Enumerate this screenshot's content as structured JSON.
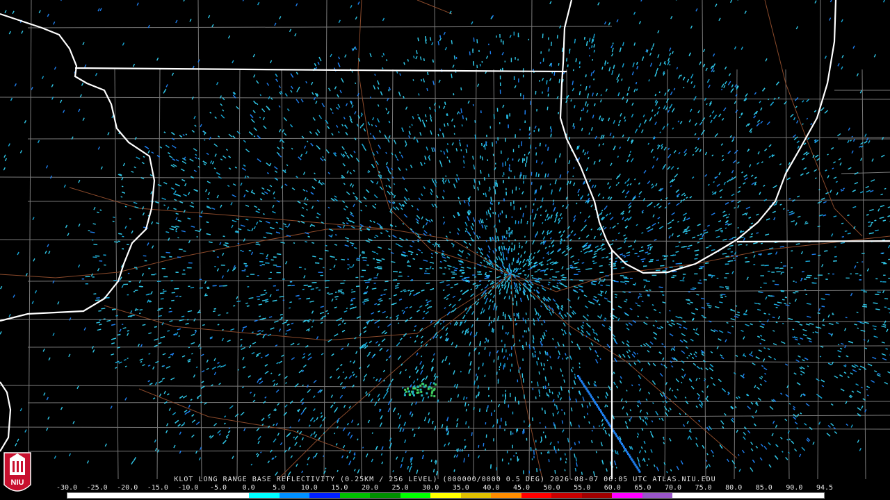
{
  "caption": {
    "site": "KLOT",
    "text": "KLOT LONG RANGE BASE REFLECTIVITY (0.25KM / 256 LEVEL) (000000/0000 0.5 DEG) 2026-08-07 06:05 UTC  ATLAS.NIU.EDU"
  },
  "logo": {
    "text": "NIU"
  },
  "colorscale": {
    "labels": [
      "-30.0",
      "-25.0",
      "-20.0",
      "-15.0",
      "-10.0",
      "-5.0",
      "0.0",
      "5.0",
      "10.0",
      "15.0",
      "20.0",
      "25.0",
      "30.0",
      "35.0",
      "40.0",
      "45.0",
      "50.0",
      "55.0",
      "60.0",
      "65.0",
      "70.0",
      "75.0",
      "80.0",
      "85.0",
      "90.0",
      "94.5"
    ],
    "colors": [
      "#ffffff",
      "#ffffff",
      "#ffffff",
      "#ffffff",
      "#ffffff",
      "#ffffff",
      "#00ffff",
      "#0090ff",
      "#0020ff",
      "#00c000",
      "#009000",
      "#00ff00",
      "#ffff00",
      "#e0c000",
      "#ff8c00",
      "#ff0000",
      "#c80000",
      "#a00000",
      "#ff00ff",
      "#9955c9",
      "#ffffff",
      "#ffffff",
      "#ffffff",
      "#ffffff",
      "#ffffff"
    ]
  },
  "colors": {
    "background": "#000000",
    "state_border": "#ffffff",
    "county_border": "#7a7a7a",
    "highway": "#8b4a2b",
    "echo_primary": "#30c8e8",
    "echo_secondary": "#1e7ff0",
    "echo_strong": "#40d060"
  }
}
